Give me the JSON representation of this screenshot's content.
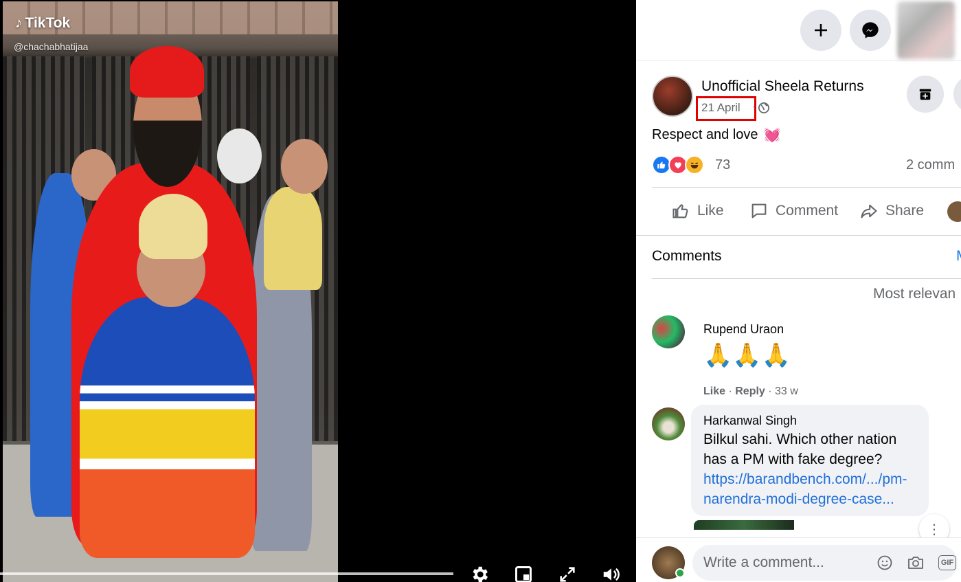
{
  "video": {
    "watermark": "TikTok",
    "handle": "@chachabhatijaa"
  },
  "post": {
    "page_name": "Unofficial Sheela Returns",
    "date": "21 April",
    "date_separator": "·",
    "text": "Respect and love",
    "text_emoji": "💓",
    "reaction_count": "73",
    "comment_count": "2 comm",
    "actions": {
      "like": "Like",
      "comment": "Comment",
      "share": "Share"
    }
  },
  "comments": {
    "heading": "Comments",
    "heading_edge": "M",
    "sort_label": "Most relevan",
    "items": [
      {
        "author": "Rupend Uraon",
        "text": "🙏🙏🙏",
        "like": "Like",
        "reply": "Reply",
        "age": "33 w"
      },
      {
        "author": "Harkanwal Singh",
        "text_line1": "Bilkul sahi. Which other nation",
        "text_line2": "has a PM with fake degree?",
        "link_line1": "https://barandbench.com/.../pm-",
        "link_line2": "narendra-modi-degree-case..."
      }
    ],
    "options": "⋮"
  },
  "composer": {
    "placeholder": "Write a comment...",
    "gif_label": "GIF"
  },
  "colors": {
    "facebook_blue": "#1877f2",
    "highlight_box": "#e00000",
    "secondary_text": "#65676b"
  }
}
